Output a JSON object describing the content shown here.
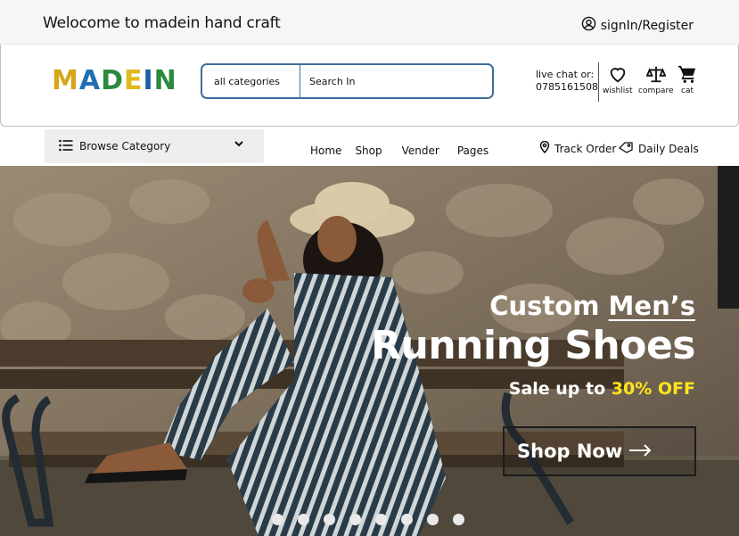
{
  "topbar": {
    "welcome": "Welocome to madein hand craft",
    "signin": "signIn/Register"
  },
  "logo": {
    "text": "MADEIN"
  },
  "search": {
    "category": "all categories",
    "placeholder": "Search In"
  },
  "contact": {
    "line1": "live chat or:",
    "phone": "0785161508"
  },
  "header_icons": {
    "wishlist": "wishlist",
    "compare": "compare",
    "cart": "cat"
  },
  "nav": {
    "browse": "Browse Category",
    "links": [
      "Home",
      "Shop",
      "Vender",
      "Pages"
    ],
    "track": "Track Order",
    "deals": "Daily Deals"
  },
  "hero": {
    "sub_prefix": "Custom",
    "sub_highlight": "Men’s",
    "title": "Running Shoes",
    "sale_prefix": "Sale up to",
    "sale_highlight": "30% OFF",
    "cta": "Shop Now",
    "highlight_color": "#ffe51a",
    "dot_count": 8
  }
}
